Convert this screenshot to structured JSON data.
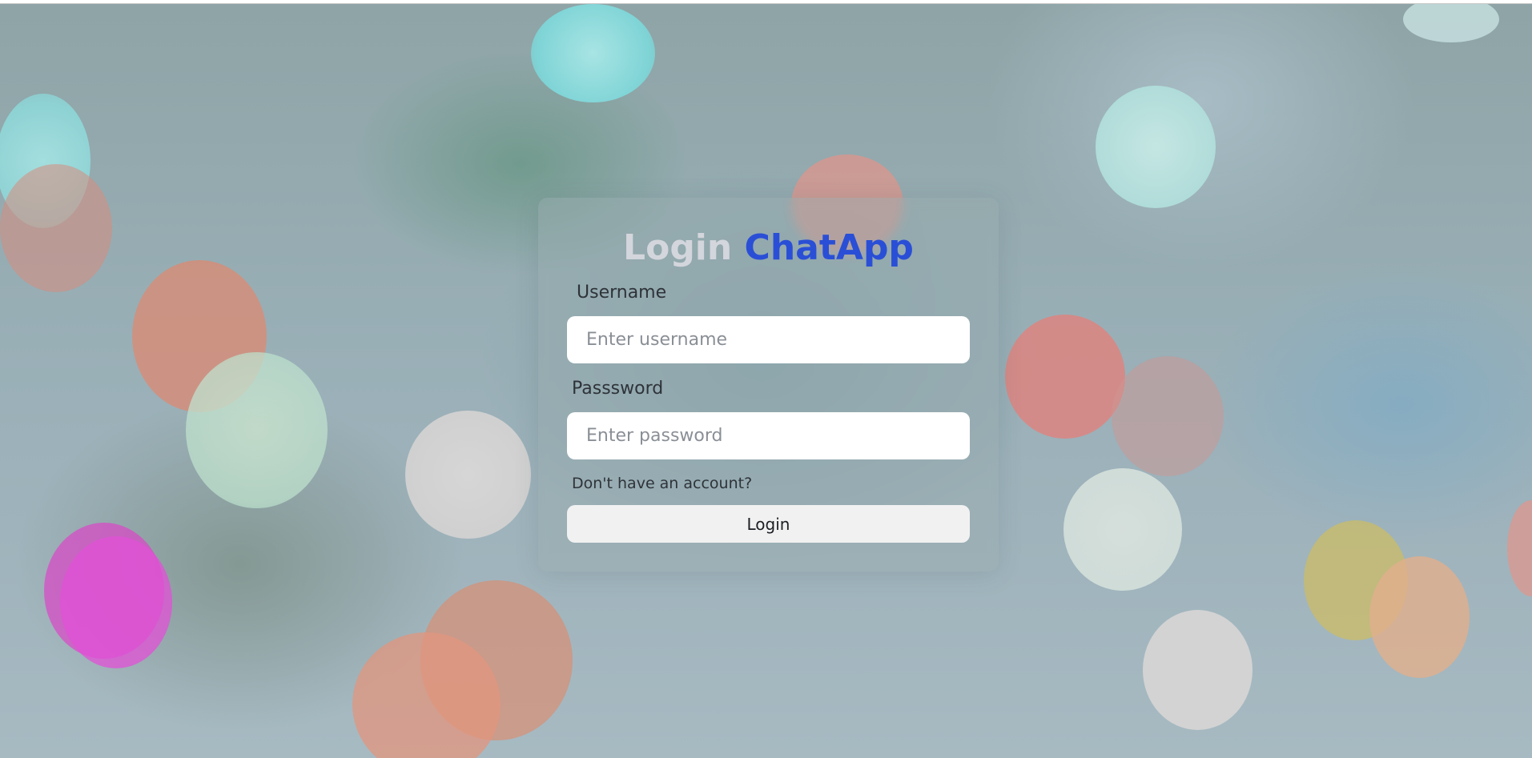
{
  "title": {
    "prefix": "Login",
    "brand": "ChatApp"
  },
  "form": {
    "username": {
      "label": "Username",
      "placeholder": "Enter username",
      "value": ""
    },
    "password": {
      "label": "Passsword",
      "placeholder": "Enter password",
      "value": ""
    },
    "signup_link": "Don't have an account?",
    "submit_label": "Login"
  },
  "colors": {
    "brand": "#2a4fd6",
    "title_prefix": "#d3d6dc",
    "button_bg": "#f1f1f1"
  }
}
